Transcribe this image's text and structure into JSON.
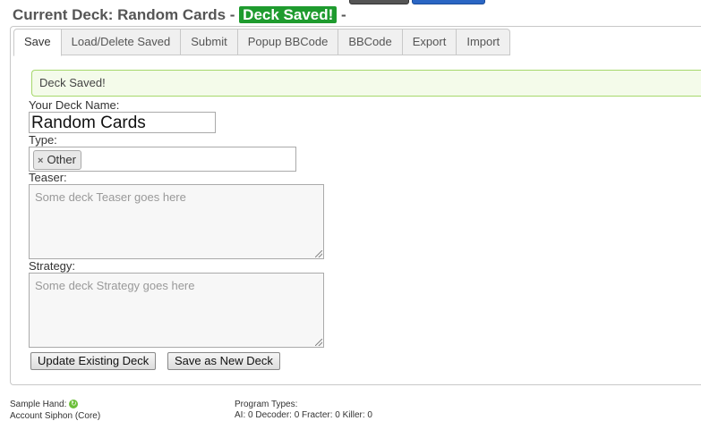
{
  "header": {
    "title_prefix": "Current Deck: Random Cards - ",
    "saved_badge": "Deck Saved!",
    "title_suffix": " -"
  },
  "tabs": [
    "Save",
    "Load/Delete Saved",
    "Submit",
    "Popup BBCode",
    "BBCode",
    "Export",
    "Import"
  ],
  "active_tab": "Save",
  "alert": {
    "text": "Deck Saved!"
  },
  "form": {
    "name_label": "Your Deck Name:",
    "name_value": "Random Cards",
    "type_label": "Type:",
    "type_tag": "Other",
    "type_tag_remove": "×",
    "teaser_label": "Teaser:",
    "teaser_placeholder": "Some deck Teaser goes here",
    "strategy_label": "Strategy:",
    "strategy_placeholder": "Some deck Strategy goes here",
    "update_button": "Update Existing Deck",
    "save_new_button": "Save as New Deck"
  },
  "footer": {
    "sample_hand_label": "Sample Hand:",
    "sample_hand_first": "Account Siphon (Core)",
    "program_types_label": "Program Types:",
    "program_types_values": "AI: 0 Decoder: 0 Fracter: 0 Killer: 0"
  },
  "colors": {
    "badge_green": "#1e9b2e",
    "alert_border": "#a6d86b",
    "alert_bg": "#f4fbea"
  }
}
